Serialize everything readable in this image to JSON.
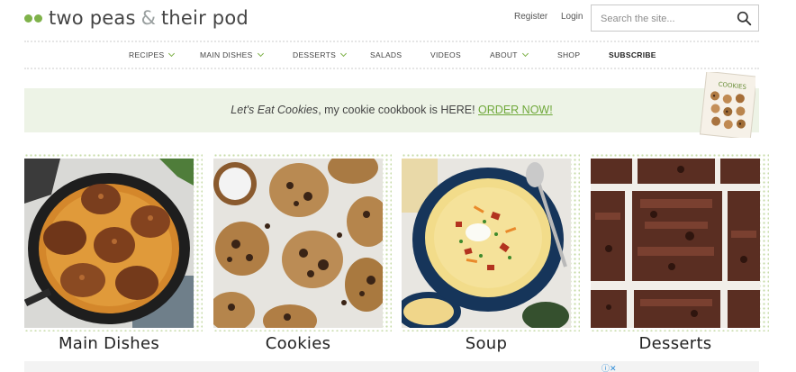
{
  "header": {
    "logo_word_1": "two peas",
    "logo_amp": "&",
    "logo_word_2": "their pod",
    "register": "Register",
    "login": "Login",
    "search_placeholder": "Search the site..."
  },
  "nav": {
    "items": [
      {
        "label": "RECIPES",
        "dropdown": true
      },
      {
        "label": "MAIN DISHES",
        "dropdown": true
      },
      {
        "label": "DESSERTS",
        "dropdown": true
      },
      {
        "label": "SALADS",
        "dropdown": false
      },
      {
        "label": "VIDEOS",
        "dropdown": false
      },
      {
        "label": "ABOUT",
        "dropdown": true
      },
      {
        "label": "SHOP",
        "dropdown": false
      },
      {
        "label": "SUBSCRIBE",
        "dropdown": false
      }
    ]
  },
  "banner": {
    "book_title": "Let's Eat Cookies",
    "text_middle": ", my cookie cookbook is HERE! ",
    "link": "ORDER NOW!",
    "cover_title": "COOKIES"
  },
  "cards": [
    {
      "label": "Main Dishes",
      "icon": "chicken-skillet-photo"
    },
    {
      "label": "Cookies",
      "icon": "chocolate-chip-cookies-photo"
    },
    {
      "label": "Soup",
      "icon": "potato-soup-photo"
    },
    {
      "label": "Desserts",
      "icon": "brownies-photo"
    }
  ],
  "ad": {
    "icons": "ⓘ✕"
  },
  "colors": {
    "brand_green": "#7fb24a",
    "banner_bg": "#edf3e6",
    "link_green": "#6fa83a"
  }
}
